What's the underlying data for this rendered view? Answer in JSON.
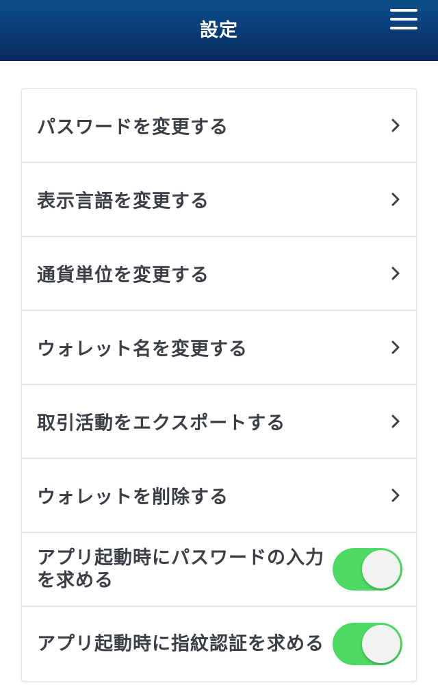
{
  "header": {
    "title": "設定",
    "menu_icon": "hamburger-menu-icon"
  },
  "settings": {
    "items": [
      {
        "label": "パスワードを変更する",
        "type": "link",
        "icon": "chevron-right-icon"
      },
      {
        "label": "表示言語を変更する",
        "type": "link",
        "icon": "chevron-right-icon"
      },
      {
        "label": "通貨単位を変更する",
        "type": "link",
        "icon": "chevron-right-icon"
      },
      {
        "label": "ウォレット名を変更する",
        "type": "link",
        "icon": "chevron-right-icon"
      },
      {
        "label": "取引活動をエクスポートする",
        "type": "link",
        "icon": "chevron-right-icon"
      },
      {
        "label": "ウォレットを削除する",
        "type": "link",
        "icon": "chevron-right-icon"
      },
      {
        "label": "アプリ起動時にパスワードの入力を求める",
        "type": "toggle",
        "enabled": true
      },
      {
        "label": "アプリ起動時に指紋認証を求める",
        "type": "toggle",
        "enabled": true
      }
    ]
  },
  "colors": {
    "header_top": "#0d4f8c",
    "header_bottom": "#082a5e",
    "toggle_on": "#4cd964",
    "text": "#3a3f45",
    "chevron": "#3a3f45"
  }
}
